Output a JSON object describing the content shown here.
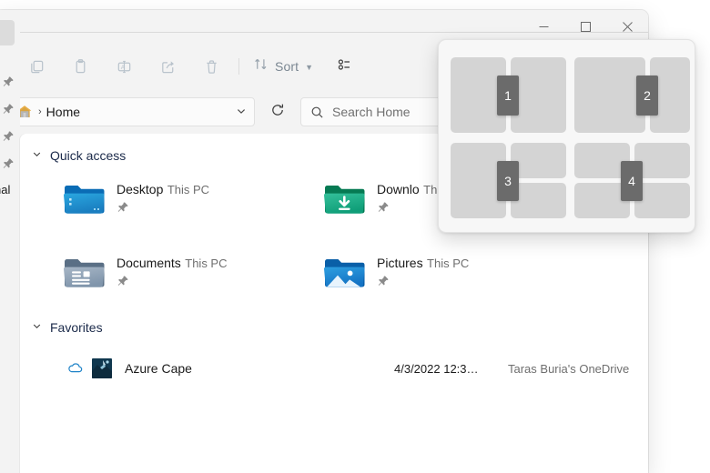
{
  "window": {
    "controls": {
      "minimize": "Minimize",
      "maximize": "Maximize",
      "close": "Close"
    }
  },
  "toolbar": {
    "copy_label": "Copy",
    "paste_label": "Paste",
    "rename_label": "Rename",
    "share_label": "Share",
    "delete_label": "Delete",
    "sort_label": "Sort",
    "view_label": "View"
  },
  "address": {
    "home_label": "Home",
    "separator": "›",
    "dropdown": "⌄",
    "refresh_label": "Refresh"
  },
  "search": {
    "placeholder": "Search Home",
    "value": ""
  },
  "navpane": {
    "visible_text": "nal"
  },
  "sections": [
    {
      "label": "Quick access"
    },
    {
      "label": "Favorites"
    }
  ],
  "quick_access": {
    "label": "Quick access",
    "items": [
      {
        "name": "Desktop",
        "sub": "This PC",
        "icon": "folder-desktop-icon",
        "pinned": true
      },
      {
        "name": "Downlo",
        "sub": "This PC",
        "icon": "folder-downloads-icon",
        "pinned": true
      },
      {
        "name": "Documents",
        "sub": "This PC",
        "icon": "folder-documents-icon",
        "pinned": true
      },
      {
        "name": "Pictures",
        "sub": "This PC",
        "icon": "folder-pictures-icon",
        "pinned": true
      }
    ]
  },
  "favorites": {
    "label": "Favorites",
    "items": [
      {
        "name": "Azure Cape",
        "date": "4/3/2022 12:3…",
        "owner": "Taras Buria's OneDrive",
        "cloud": true
      }
    ]
  },
  "snap_layouts": {
    "options": [
      {
        "number": "1",
        "name": "two-columns-equal"
      },
      {
        "number": "2",
        "name": "two-columns-wide-left"
      },
      {
        "number": "3",
        "name": "left-full-right-stacked"
      },
      {
        "number": "4",
        "name": "four-quadrants"
      }
    ]
  },
  "colors": {
    "window_bg": "#f3f3f3",
    "content_bg": "#ffffff",
    "pane_fill": "#d4d4d4",
    "badge_fill": "#6b6b6b",
    "section_text": "#1b2a4a",
    "toolbar_icon": "#b9c3cc",
    "cloud_blue": "#1f83c8"
  }
}
